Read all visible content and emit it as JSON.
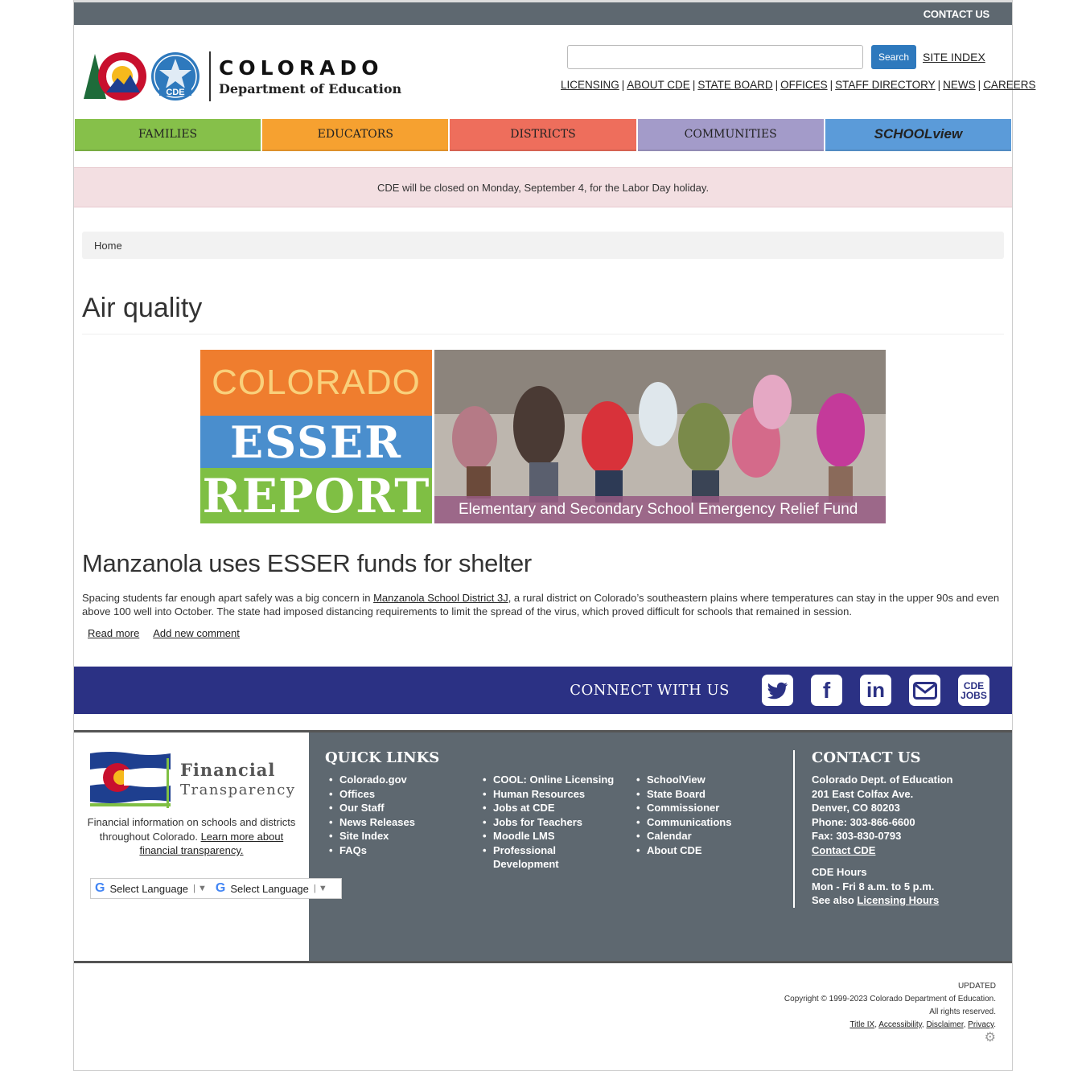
{
  "topbar": {
    "contact": "CONTACT US"
  },
  "logo": {
    "line1": "COLORADO",
    "line2": "Department of Education",
    "badge": "CDE"
  },
  "search": {
    "button": "Search",
    "placeholder": ""
  },
  "site_index": "SITE INDEX",
  "utility_links": [
    "LICENSING",
    "ABOUT CDE",
    "STATE BOARD",
    "OFFICES",
    "STAFF DIRECTORY",
    "NEWS",
    "CAREERS"
  ],
  "nav": [
    {
      "label": "FAMILIES",
      "color": "#86c04a"
    },
    {
      "label": "EDUCATORS",
      "color": "#f6a130"
    },
    {
      "label": "DISTRICTS",
      "color": "#ee6e5c"
    },
    {
      "label": "COMMUNITIES",
      "color": "#a39bc9"
    },
    {
      "label": "SCHOOLview",
      "color": "#5b9bd9"
    }
  ],
  "alert": "CDE will be closed on Monday, September 4, for the Labor Day holiday.",
  "breadcrumb": "Home",
  "page_title": "Air quality",
  "banner": {
    "line1": "COLORADO",
    "line2": "ESSER",
    "line3": "REPORT",
    "caption": "Elementary and Secondary School Emergency Relief Fund"
  },
  "article": {
    "title": "Manzanola uses ESSER funds for shelter",
    "text_before": "Spacing students far enough apart safely was a big concern in ",
    "link": "Manzanola School District 3J",
    "text_after": ", a rural district on Colorado’s southeastern plains where temperatures can stay in the upper 90s and even above 100 well into October. The state had imposed distancing requirements to limit the spread of the virus, which proved difficult for schools that remained in session.",
    "read_more": "Read more",
    "add_comment": "Add new comment"
  },
  "connect": {
    "label": "CONNECT WITH US",
    "icons": [
      "twitter-icon",
      "facebook-icon",
      "linkedin-icon",
      "email-icon",
      "cde-jobs-icon"
    ],
    "jobs_line1": "CDE",
    "jobs_line2": "JOBS"
  },
  "financial": {
    "word1": "Financial",
    "word2": "Transparency",
    "desc": "Financial information on schools and districts throughout Colorado. ",
    "link": "Learn more about financial transparency."
  },
  "translate": {
    "label1": "Select Language",
    "label2": "Select Language"
  },
  "quick_links": {
    "title": "QUICK LINKS",
    "col1": [
      "Colorado.gov",
      "Offices",
      "Our Staff",
      "News Releases",
      "Site Index",
      "FAQs"
    ],
    "col2": [
      "COOL: Online Licensing",
      "Human Resources",
      "Jobs at CDE",
      "Jobs for Teachers",
      "Moodle LMS",
      "Professional Development"
    ],
    "col3": [
      "SchoolView",
      "State Board",
      "Commissioner",
      "Communications",
      "Calendar",
      "About CDE"
    ]
  },
  "contact": {
    "title": "CONTACT US",
    "lines": [
      "Colorado Dept. of Education",
      "201 East Colfax Ave.",
      "Denver, CO 80203",
      "Phone: 303-866-6600",
      "Fax: 303-830-0793"
    ],
    "link": "Contact CDE",
    "hours_title": "CDE Hours",
    "hours": "Mon - Fri 8 a.m. to 5 p.m.",
    "see_also": "See also ",
    "licensing_hours": "Licensing Hours"
  },
  "bottom": {
    "updated": "UPDATED",
    "copyright": "Copyright © 1999-2023 Colorado Department of Education.",
    "rights": "All rights reserved.",
    "links": [
      "Title IX",
      "Accessibility",
      "Disclaimer",
      "Privacy"
    ]
  }
}
